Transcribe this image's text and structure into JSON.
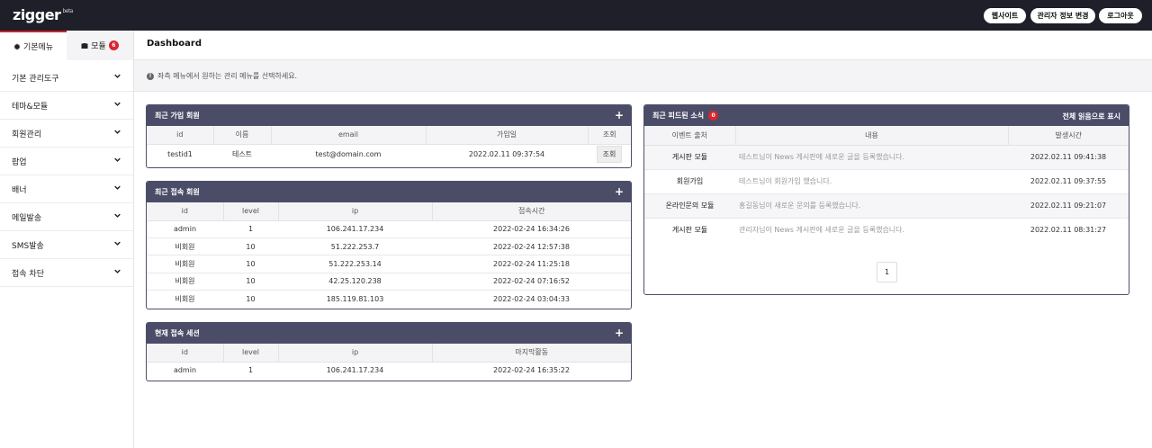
{
  "app": {
    "logo": "zigger",
    "logo_sup": "beta"
  },
  "topnav": {
    "website": "웹사이트",
    "admin_info": "관리자 정보 변경",
    "logout": "로그아웃"
  },
  "sidebar": {
    "tabs": [
      {
        "label": "기본메뉴",
        "icon": "gear-icon"
      },
      {
        "label": "모듈",
        "icon": "briefcase-icon",
        "badge": "6"
      }
    ],
    "items": [
      {
        "label": "기본 관리도구"
      },
      {
        "label": "테마&모듈"
      },
      {
        "label": "회원관리"
      },
      {
        "label": "팝업"
      },
      {
        "label": "배너"
      },
      {
        "label": "메일발송"
      },
      {
        "label": "SMS발송"
      },
      {
        "label": "접속 차단"
      }
    ]
  },
  "main": {
    "title": "Dashboard",
    "notice": "좌측 메뉴에서 원하는 관리 메뉴를 선택하세요."
  },
  "recent_members": {
    "title": "최근 가입 회원",
    "headers": [
      "id",
      "이름",
      "email",
      "가입일",
      "조회"
    ],
    "rows": [
      {
        "id": "testid1",
        "name": "테스트",
        "email": "test@domain.com",
        "date": "2022.02.11 09:37:54",
        "action": "조회"
      }
    ]
  },
  "recent_visitors": {
    "title": "최근 접속 회원",
    "headers": [
      "id",
      "level",
      "ip",
      "접속시간"
    ],
    "rows": [
      {
        "id": "admin",
        "level": "1",
        "ip": "106.241.17.234",
        "time": "2022-02-24 16:34:26"
      },
      {
        "id": "비회원",
        "level": "10",
        "ip": "51.222.253.7",
        "time": "2022-02-24 12:57:38"
      },
      {
        "id": "비회원",
        "level": "10",
        "ip": "51.222.253.14",
        "time": "2022-02-24 11:25:18"
      },
      {
        "id": "비회원",
        "level": "10",
        "ip": "42.25.120.238",
        "time": "2022-02-24 07:16:52"
      },
      {
        "id": "비회원",
        "level": "10",
        "ip": "185.119.81.103",
        "time": "2022-02-24 03:04:33"
      }
    ]
  },
  "sessions": {
    "title": "현재 접속 세션",
    "headers": [
      "id",
      "level",
      "ip",
      "마지막활동"
    ],
    "rows": [
      {
        "id": "admin",
        "level": "1",
        "ip": "106.241.17.234",
        "time": "2022-02-24 16:35:22"
      }
    ]
  },
  "feeds": {
    "title": "최근 피드된 소식",
    "badge": "0",
    "read_all": "전체 읽음으로 표시",
    "headers": [
      "이벤트 출처",
      "내용",
      "발생시간"
    ],
    "rows": [
      {
        "source": "게시판 모듈",
        "content": "테스트님이 News 게시판에 새로운 글을 등록했습니다.",
        "time": "2022.02.11 09:41:38"
      },
      {
        "source": "회원가입",
        "content": "테스트님이 회원가입 했습니다.",
        "time": "2022.02.11 09:37:55"
      },
      {
        "source": "온라인문의 모듈",
        "content": "홍길동님이 새로운 문의를 등록했습니다.",
        "time": "2022.02.11 09:21:07"
      },
      {
        "source": "게시판 모듈",
        "content": "관리자님이 News 게시판에 새로운 글을 등록했습니다.",
        "time": "2022.02.11 08:31:27"
      }
    ],
    "page": "1"
  }
}
